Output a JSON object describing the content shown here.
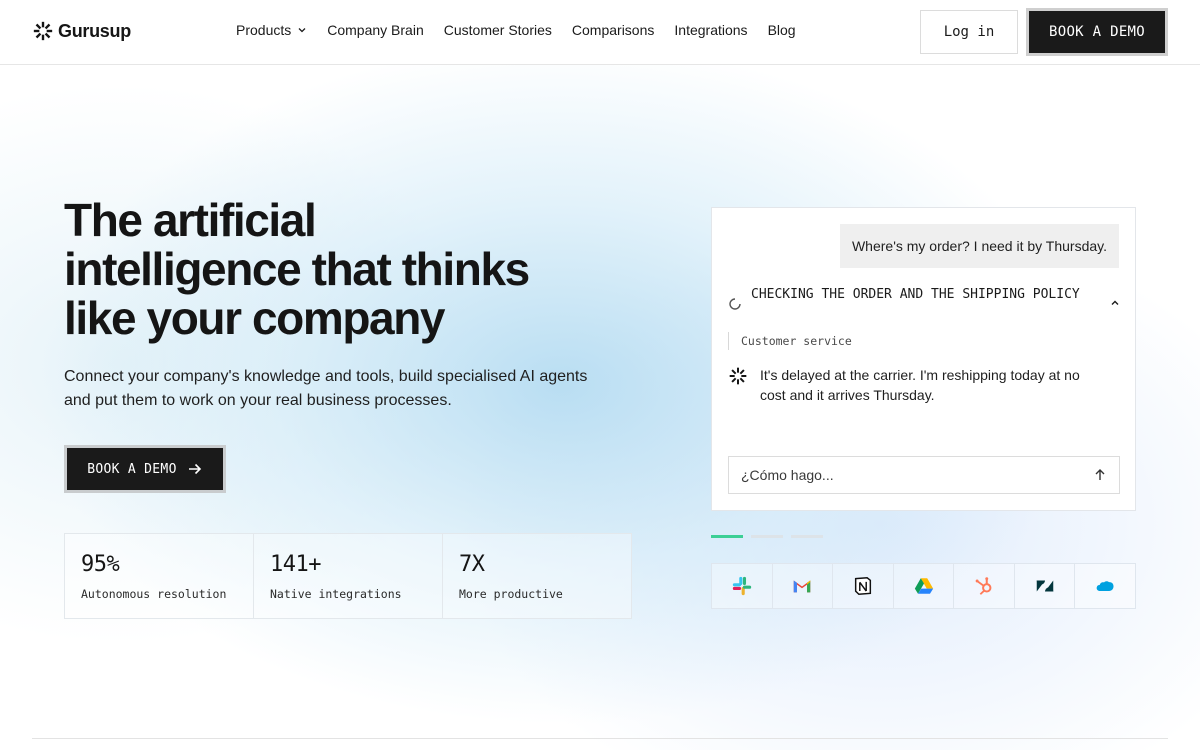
{
  "header": {
    "logo_text": "Gurusup",
    "nav": [
      {
        "label": "Products",
        "has_dropdown": true
      },
      {
        "label": "Company Brain"
      },
      {
        "label": "Customer Stories"
      },
      {
        "label": "Comparisons"
      },
      {
        "label": "Integrations"
      },
      {
        "label": "Blog"
      }
    ],
    "login_label": "Log in",
    "demo_label": "BOOK A DEMO"
  },
  "hero": {
    "title_line1": "The artificial",
    "title_line2": "intelligence that thinks",
    "title_line3": "like your company",
    "subtitle_line1": "Connect your company's knowledge and tools, build specialised AI agents",
    "subtitle_line2": "and put them to work on your real business processes.",
    "cta_label": "BOOK A DEMO",
    "cta_icon": "arrow-right-icon"
  },
  "stats": [
    {
      "value": "95%",
      "label": "Autonomous resolution"
    },
    {
      "value": "141+",
      "label": "Native integrations"
    },
    {
      "value": "7X",
      "label": "More productive"
    }
  ],
  "chat": {
    "user_message": "Where's my order? I need it by Thursday.",
    "status_text": "CHECKING THE ORDER AND THE SHIPPING POLICY",
    "tag": "Customer service",
    "answer_line1": "It's delayed at the carrier. I'm reshipping today at no",
    "answer_line2": "cost and it arrives Thursday.",
    "input_placeholder": "¿Cómo hago...",
    "send_icon": "arrow-up-icon"
  },
  "carousel": {
    "count": 3,
    "active": 0
  },
  "integrations": [
    "slack-icon",
    "gmail-icon",
    "notion-icon",
    "google-drive-icon",
    "hubspot-icon",
    "zendesk-icon",
    "salesforce-icon"
  ],
  "colors": {
    "accent_dark": "#1a1a1a",
    "carousel_active": "#3ccf95",
    "glow": "#b9def2"
  }
}
